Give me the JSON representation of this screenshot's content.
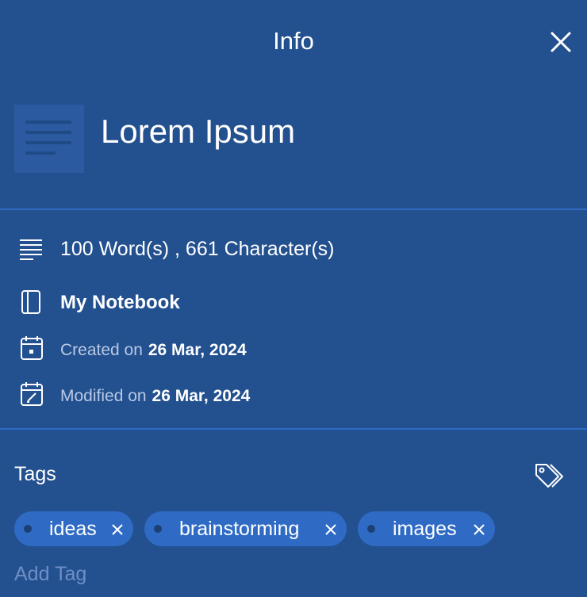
{
  "header": {
    "title": "Info"
  },
  "note": {
    "title": "Lorem Ipsum"
  },
  "details": {
    "counts": "100 Word(s) , 661 Character(s)",
    "notebook": "My Notebook",
    "created_label": "Created on",
    "created_date": "26 Mar, 2024",
    "modified_label": "Modified on",
    "modified_date": "26 Mar, 2024"
  },
  "tags": {
    "label": "Tags",
    "items": [
      {
        "label": "ideas"
      },
      {
        "label": "brainstorming"
      },
      {
        "label": "images"
      }
    ],
    "add_placeholder": "Add Tag",
    "add_value": ""
  },
  "colors": {
    "background": "#23508f",
    "divider": "#2f6bc4",
    "chip": "#2f6bc4",
    "muted_text": "#b9c9e4"
  },
  "icons": {
    "close": "close-icon",
    "note": "note-lines-icon",
    "counts": "text-lines-icon",
    "notebook": "notebook-icon",
    "created": "calendar-icon",
    "modified": "calendar-edit-icon",
    "tag": "tags-icon",
    "remove": "remove-tag-icon"
  }
}
